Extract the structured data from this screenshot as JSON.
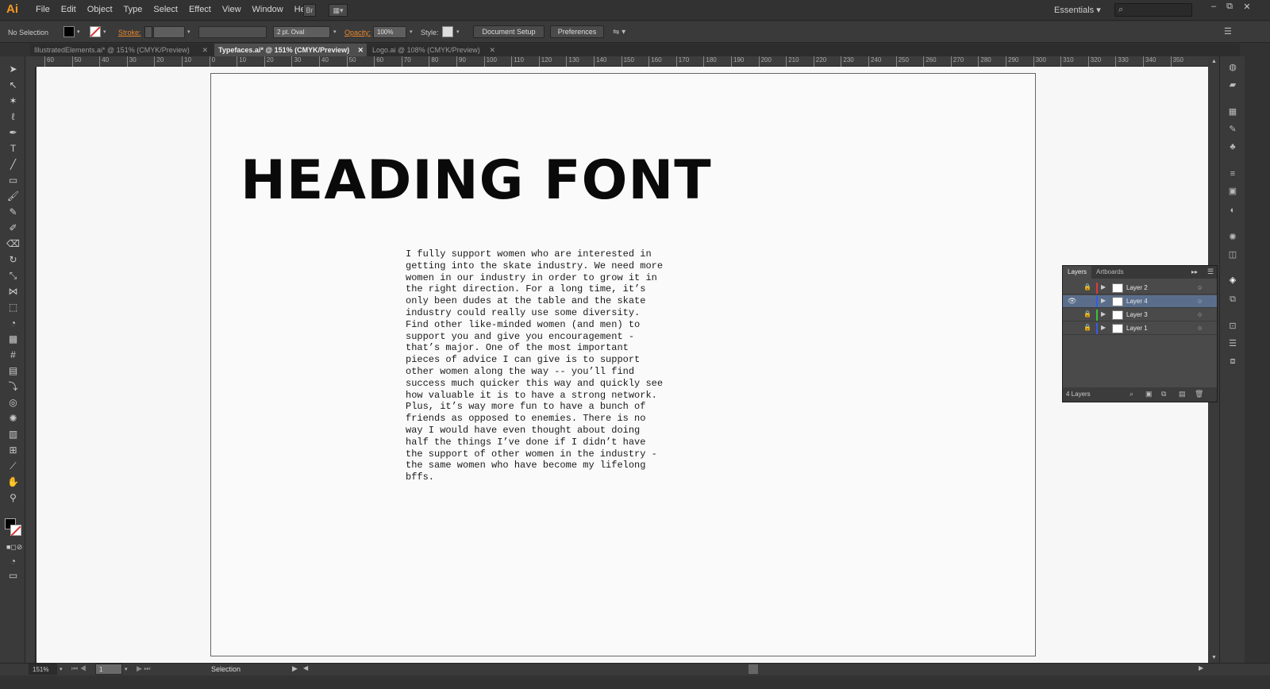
{
  "app": {
    "logo": "Ai"
  },
  "menu": [
    "File",
    "Edit",
    "Object",
    "Type",
    "Select",
    "Effect",
    "View",
    "Window",
    "Help"
  ],
  "bridge_btn": "Br",
  "workspace": "Essentials",
  "search_icon": "⌕",
  "window_controls": [
    "–",
    "⧉",
    "✕"
  ],
  "control": {
    "selection": "No Selection",
    "stroke_label": "Stroke:",
    "brush": "2 pt. Oval",
    "opacity_label": "Opacity:",
    "opacity_value": "100%",
    "style_label": "Style:",
    "doc_setup": "Document Setup",
    "preferences": "Preferences"
  },
  "tabs": [
    {
      "label": "IllustratedElements.ai* @ 151% (CMYK/Preview)",
      "close": "✕"
    },
    {
      "label": "Typefaces.ai* @ 151% (CMYK/Preview)",
      "close": "✕"
    },
    {
      "label": "Logo.ai @ 108% (CMYK/Preview)",
      "close": "✕"
    }
  ],
  "ruler_labels": [
    "60",
    "50",
    "40",
    "30",
    "20",
    "10",
    "0",
    "10",
    "20",
    "30",
    "40",
    "50",
    "60",
    "70",
    "80",
    "90",
    "100",
    "110",
    "120",
    "130",
    "140",
    "150",
    "160",
    "170",
    "180",
    "190",
    "200",
    "210",
    "220",
    "230",
    "240",
    "250",
    "260",
    "270",
    "280",
    "290",
    "300",
    "310",
    "320",
    "330",
    "340",
    "350"
  ],
  "artboard": {
    "heading": "HEADING FONT",
    "body": "I fully support women who are interested in\ngetting into the skate industry. We need more\nwomen in our industry in order to grow it in\nthe right direction. For a long time, it’s\nonly been dudes at the table and the skate\nindustry could really use some diversity.\nFind other like-minded women (and men) to\nsupport you and give you encouragement -\nthat’s major. One of the most important\npieces of advice I can give is to support\nother women along the way -- you’ll find\nsuccess much quicker this way and quickly see\nhow valuable it is to have a strong network.\nPlus, it’s way more fun to have a bunch of\nfriends as opposed to enemies. There is no\nway I would have even thought about doing\nhalf the things I’ve done if I didn’t have\nthe support of other women in the industry -\nthe same women who have become my lifelong\nbffs."
  },
  "layers_panel": {
    "tabs": [
      "Layers",
      "Artboards"
    ],
    "layers": [
      {
        "name": "Layer 2",
        "color": "#e03a3a",
        "locked": true,
        "visible": false,
        "selected": false
      },
      {
        "name": "Layer 4",
        "color": "#3a5ce0",
        "locked": false,
        "visible": true,
        "selected": true
      },
      {
        "name": "Layer 3",
        "color": "#3ac23a",
        "locked": true,
        "visible": false,
        "selected": false
      },
      {
        "name": "Layer 1",
        "color": "#3a5ce0",
        "locked": true,
        "visible": false,
        "selected": false
      }
    ],
    "count": "4 Layers"
  },
  "status": {
    "zoom": "151%",
    "page": "1",
    "tool": "Selection"
  }
}
